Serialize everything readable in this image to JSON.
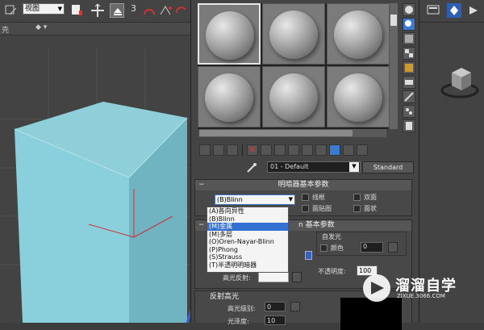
{
  "toolbar": {
    "view_select": "视图",
    "numeric_label": "3"
  },
  "viewport": {
    "label": "壳",
    "dropdown": "◆ ▾"
  },
  "material_editor": {
    "material_name": "01 - Default",
    "material_type": "Standard",
    "shader_rollout_title": "明暗器基本参数",
    "shader_selected": "(B)Blinn",
    "shader_options": [
      "(A)各向异性",
      "(B)Blinn",
      "(M)金属",
      "(M)多层",
      "(O)Oren-Nayar-Blinn",
      "(P)Phong",
      "(S)Strauss",
      "(T)半透明明暗器"
    ],
    "shader_highlighted_index": 2,
    "checkboxes": [
      "线框",
      "双面",
      "面贴图",
      "面状"
    ],
    "basic_rollout_title_suffix": "n 基本参数",
    "self_illum_label": "自发光",
    "color_label": "颜色",
    "color_value": "0",
    "opacity_label": "不透明度:",
    "opacity_value": "100",
    "specular_label": "高光反射:",
    "highlight_title": "反射高光",
    "glossiness_label": "高光级别:",
    "glossiness_value": "0",
    "softness_label": "光泽度:",
    "softness_value": "10"
  },
  "watermark": {
    "name": "溜溜自学",
    "url": "ZIXUE.3066.COM"
  },
  "colors": {
    "cube_top": "#8fcfd9",
    "cube_front": "#8ad0dc",
    "cube_side": "#6fb4c0",
    "highlight_blue": "#3470d1"
  }
}
